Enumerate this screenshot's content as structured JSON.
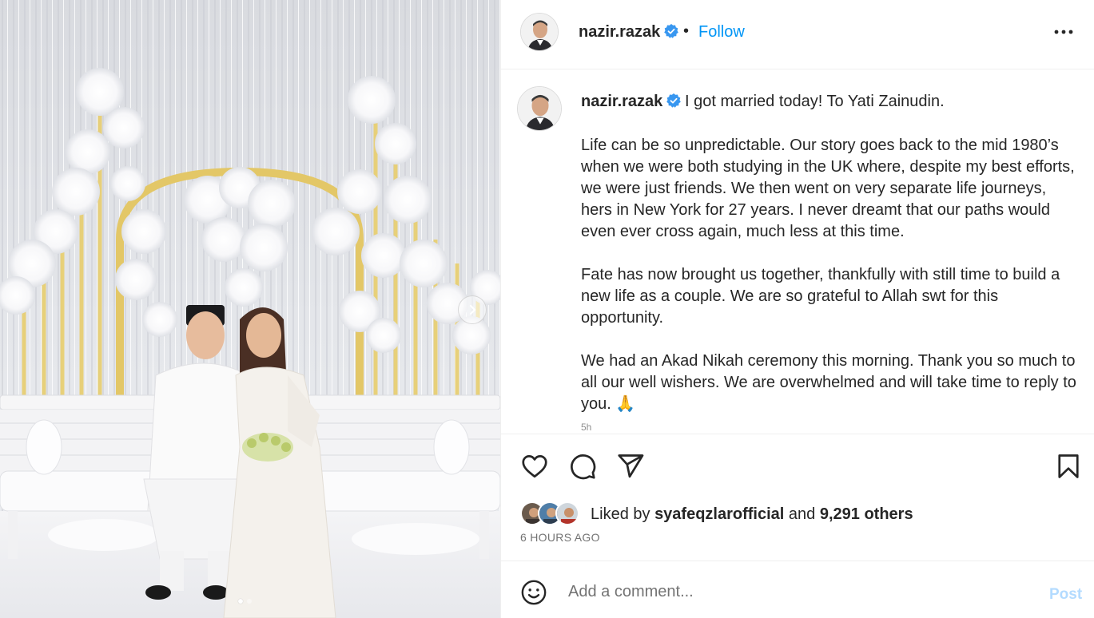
{
  "post_header": {
    "username": "nazir.razak",
    "separator": "•",
    "follow_label": "Follow"
  },
  "caption": {
    "username": "nazir.razak",
    "first_line": "I got married today! To Yati Zainudin.",
    "paragraphs": [
      "Life can be so unpredictable. Our story goes back to the mid 1980’s when we were both studying in the UK where, despite my best efforts, we were just friends. We then went on very separate life journeys, hers in New York for 27 years. I never dreamt that our paths would even ever cross again, much less at this time.",
      "Fate has now brought us together, thankfully with still time to build a new life as a couple. We are so grateful to Allah swt for this opportunity.",
      "We had an Akad Nikah ceremony this morning. Thank you so much to all our well wishers. We are overwhelmed and will take time to reply to you. 🙏"
    ],
    "truncated_timestamp": "5h"
  },
  "likes": {
    "prefix": "Liked by",
    "first_liker": "syafeqzlarofficial",
    "joiner": "and",
    "others": "9,291 others"
  },
  "time_ago": "6 HOURS AGO",
  "comment": {
    "placeholder": "Add a comment...",
    "post_label": "Post"
  },
  "icons": {
    "verified": "verified-badge-icon",
    "more": "more-options-icon",
    "like": "heart-icon",
    "comment": "comment-bubble-icon",
    "share": "paper-plane-icon",
    "save": "bookmark-icon",
    "emoji": "smiley-icon",
    "next": "chevron-right-icon"
  },
  "colors": {
    "accent": "#0095f6",
    "verified": "#3897f0",
    "text": "#262626",
    "muted": "#737373",
    "post_disabled": "#b3dbff"
  },
  "carousel": {
    "slide_count": 2,
    "active_slide": 1
  }
}
